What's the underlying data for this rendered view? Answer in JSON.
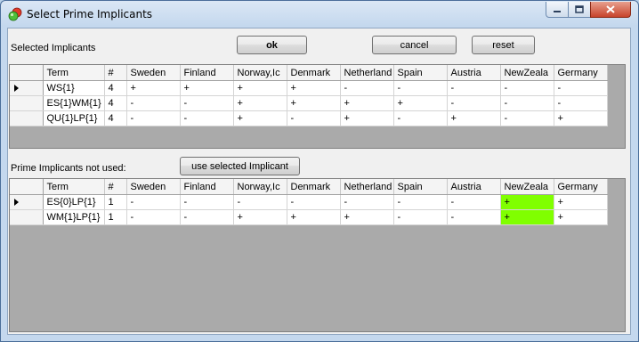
{
  "window": {
    "title": "Select Prime Implicants",
    "colors": {
      "highlight": "#80ff00",
      "grid_bg": "#aaaaaa"
    }
  },
  "labels": {
    "selected": "Selected Implicants",
    "not_used": "Prime Implicants not used:"
  },
  "buttons": {
    "ok": "ok",
    "cancel": "cancel",
    "reset": "reset",
    "use_selected": "use selected Implicant"
  },
  "columns": [
    "Term",
    "#",
    "Sweden",
    "Finland",
    "Norway,Ic",
    "Denmark",
    "Netherland",
    "Spain",
    "Austria",
    "NewZeala",
    "Germany"
  ],
  "selected_rows": [
    {
      "current": true,
      "cells": [
        "WS{1}",
        "4",
        "+",
        "+",
        "+",
        "+",
        "-",
        "-",
        "-",
        "-",
        "-"
      ]
    },
    {
      "current": false,
      "cells": [
        "ES{1}WM{1}",
        "4",
        "-",
        "-",
        "+",
        "+",
        "+",
        "+",
        "-",
        "-",
        "-"
      ]
    },
    {
      "current": false,
      "cells": [
        "QU{1}LP{1}",
        "4",
        "-",
        "-",
        "+",
        "-",
        "+",
        "-",
        "+",
        "-",
        "+"
      ]
    }
  ],
  "unused_rows": [
    {
      "current": true,
      "cells": [
        "ES{0}LP{1}",
        "1",
        "-",
        "-",
        "-",
        "-",
        "-",
        "-",
        "-",
        "+",
        "+"
      ],
      "highlight_col": 9
    },
    {
      "current": false,
      "cells": [
        "WM{1}LP{1}",
        "1",
        "-",
        "-",
        "+",
        "+",
        "+",
        "-",
        "-",
        "+",
        "+"
      ],
      "highlight_col": 9
    }
  ]
}
